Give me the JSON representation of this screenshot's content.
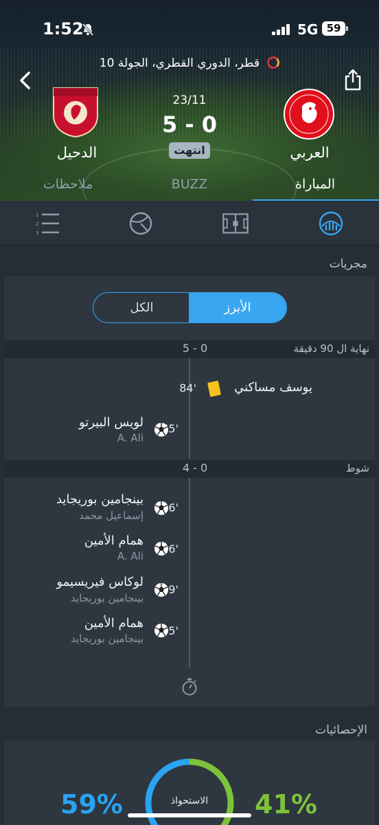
{
  "status_bar": {
    "time": "1:52",
    "network": "5G",
    "battery": "59"
  },
  "header": {
    "league": "قطر، الدوري القطري، الجولة 10",
    "date": "23/11",
    "score": "5 - 0",
    "status": "انتهت",
    "home_team": "العربي",
    "away_team": "الدحيل"
  },
  "tabs": [
    {
      "label": "المباراة",
      "active": true
    },
    {
      "label": "BUZZ",
      "active": false
    },
    {
      "label": "ملاحظات",
      "active": false
    }
  ],
  "icon_bar": [
    "stats-icon",
    "pitch-icon",
    "ball-icon",
    "list-icon"
  ],
  "events_section": {
    "title": "مجريات",
    "toggle": {
      "active": "الأبرز",
      "inactive": "الكل"
    },
    "periods": [
      {
        "label": "نهاية ال 90 دقيقة",
        "score": "5 - 0",
        "events": [
          {
            "minute": "84'",
            "type": "yellow-card",
            "side": "home",
            "player": "يوسف مساكني",
            "assist": ""
          },
          {
            "minute": "65'",
            "type": "goal",
            "side": "away",
            "player": "لويس البيرتو",
            "assist": "A. Ali"
          }
        ]
      },
      {
        "label": "شوط",
        "score": "4 - 0",
        "events": [
          {
            "minute": "26'",
            "type": "goal",
            "side": "away",
            "player": "بينجامين بوريجايد",
            "assist": "إسماعيل محمد"
          },
          {
            "minute": "16'",
            "type": "goal",
            "side": "away",
            "player": "همام الأمين",
            "assist": "A. Ali"
          },
          {
            "minute": "9'",
            "type": "goal",
            "side": "away",
            "player": "لوكاس فيريسيمو",
            "assist": "بينجامين بوريجايد"
          },
          {
            "minute": "5'",
            "type": "goal",
            "side": "away",
            "player": "همام الأمين",
            "assist": "بينجامين بوريجايد"
          }
        ]
      }
    ]
  },
  "stats_section": {
    "title": "الإحصائيات",
    "possession_label": "الاستحواذ",
    "home_pct": "41%",
    "away_pct": "59%",
    "home_value": 41,
    "away_value": 59,
    "colors": {
      "home": "#7cc23a",
      "away": "#2aa3f0"
    }
  },
  "colors": {
    "accent": "#38a6f0",
    "yellow_card": "#f4c21e",
    "background": "#262d35"
  }
}
